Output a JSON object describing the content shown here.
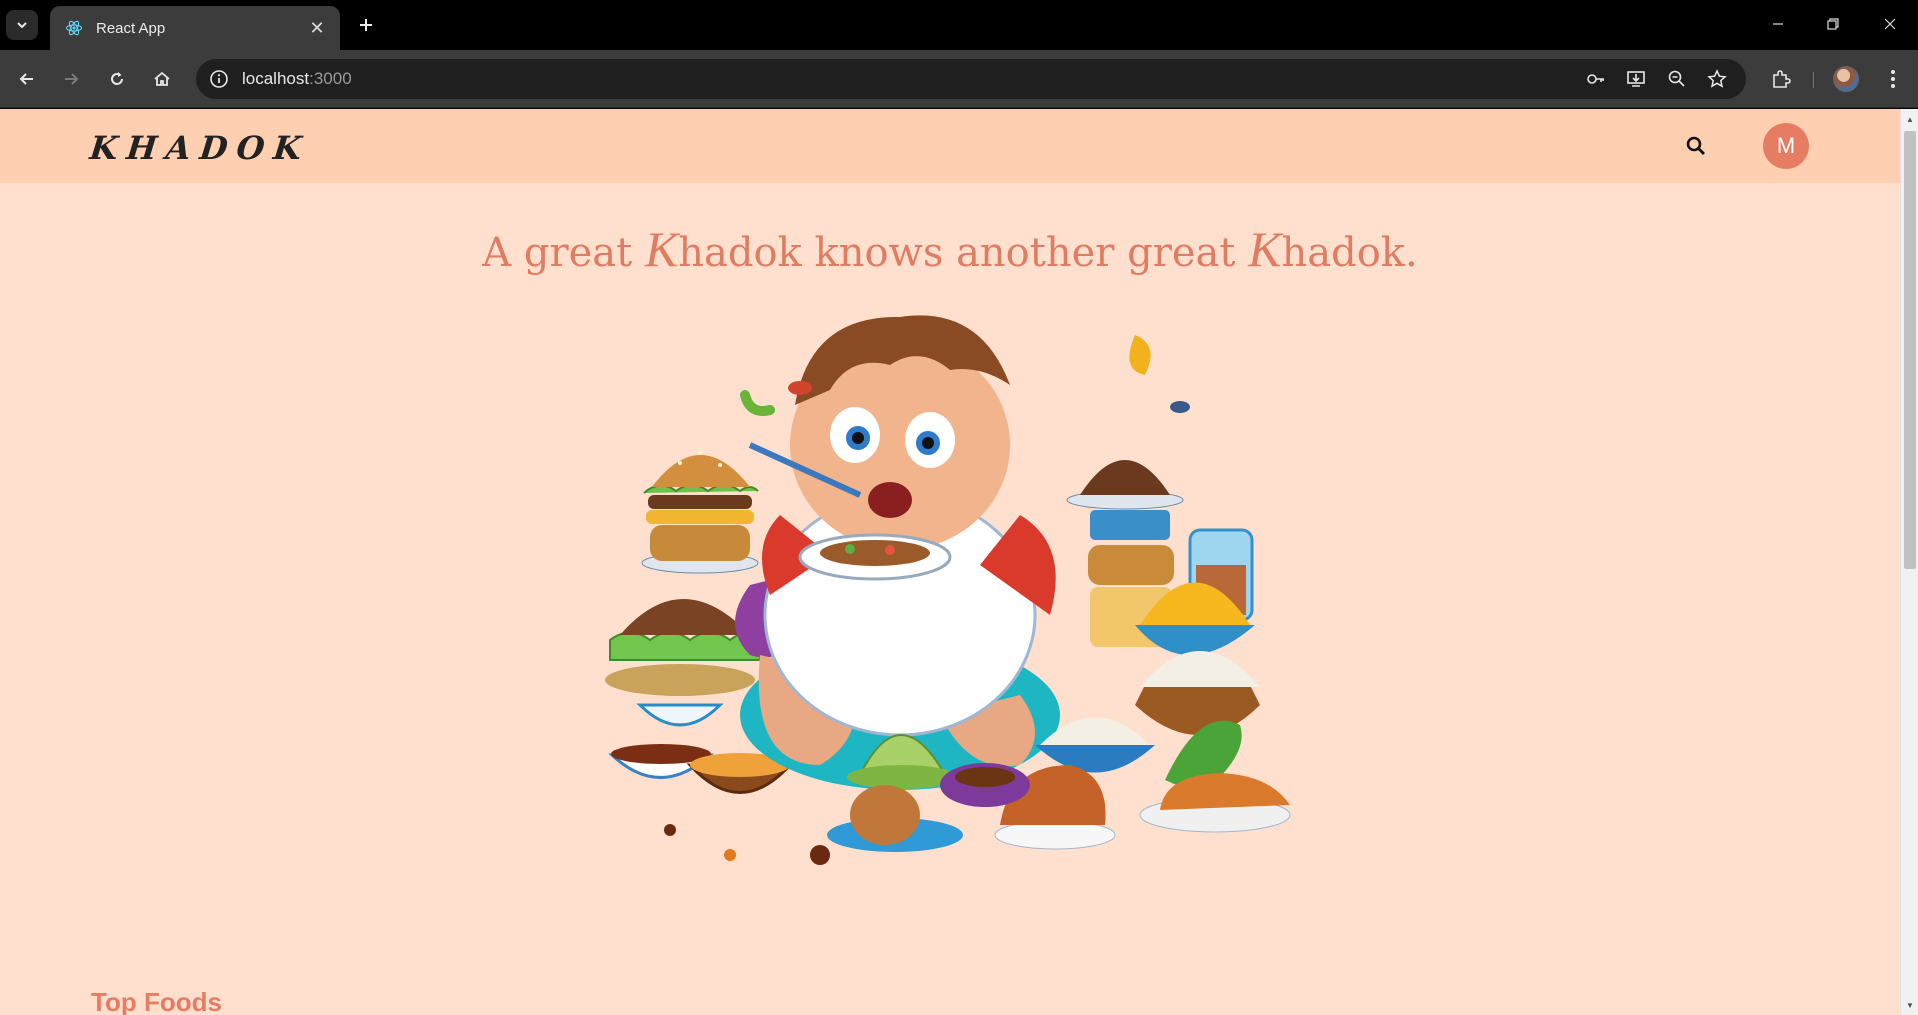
{
  "browser": {
    "tab_title": "React App",
    "url_host": "localhost",
    "url_port": ":3000"
  },
  "header": {
    "logo": "KHADOK",
    "avatar_initial": "M"
  },
  "hero": {
    "tagline_1": "A great ",
    "tagline_k1": "K",
    "tagline_2": "hadok knows another great ",
    "tagline_k2": "K",
    "tagline_3": "hadok."
  },
  "sections": {
    "top_foods_title": "Top Foods"
  },
  "colors": {
    "header_bg": "#ffcfb2",
    "page_bg": "#ffe0cf",
    "accent": "#e67d62"
  }
}
